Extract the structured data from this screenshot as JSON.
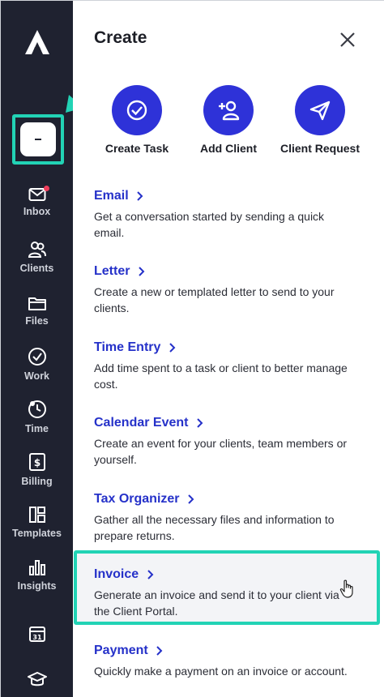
{
  "panel": {
    "title": "Create"
  },
  "quick_actions": [
    {
      "label": "Create Task",
      "icon": "check-circle-icon"
    },
    {
      "label": "Add Client",
      "icon": "add-user-icon"
    },
    {
      "label": "Client Request",
      "icon": "send-icon"
    }
  ],
  "items": [
    {
      "title": "Email",
      "desc": "Get a conversation started by sending a quick email."
    },
    {
      "title": "Letter",
      "desc": "Create a new or templated letter to send to your clients."
    },
    {
      "title": "Time Entry",
      "desc": "Add time spent to a task or client to better manage cost."
    },
    {
      "title": "Calendar Event",
      "desc": "Create an event for your clients, team members or yourself."
    },
    {
      "title": "Tax Organizer",
      "desc": "Gather all the necessary files and information to prepare returns."
    },
    {
      "title": "Invoice",
      "desc": "Generate an invoice and send it to your client via the Client Portal."
    },
    {
      "title": "Payment",
      "desc": "Quickly make a payment on an invoice or account."
    }
  ],
  "sidebar": {
    "create_button_glyph": "-",
    "calendar_day": "31",
    "nav": [
      {
        "label": "Inbox",
        "icon": "mail-icon"
      },
      {
        "label": "Clients",
        "icon": "users-icon"
      },
      {
        "label": "Files",
        "icon": "folder-icon"
      },
      {
        "label": "Work",
        "icon": "check-circle-icon"
      },
      {
        "label": "Time",
        "icon": "clock-icon"
      },
      {
        "label": "Billing",
        "icon": "dollar-doc-icon"
      },
      {
        "label": "Templates",
        "icon": "layout-icon"
      },
      {
        "label": "Insights",
        "icon": "bar-chart-icon"
      }
    ]
  },
  "colors": {
    "accent": "#2e32d8",
    "highlight": "#22d3b5",
    "sidebar": "#1f2230",
    "link": "#2531c9"
  }
}
